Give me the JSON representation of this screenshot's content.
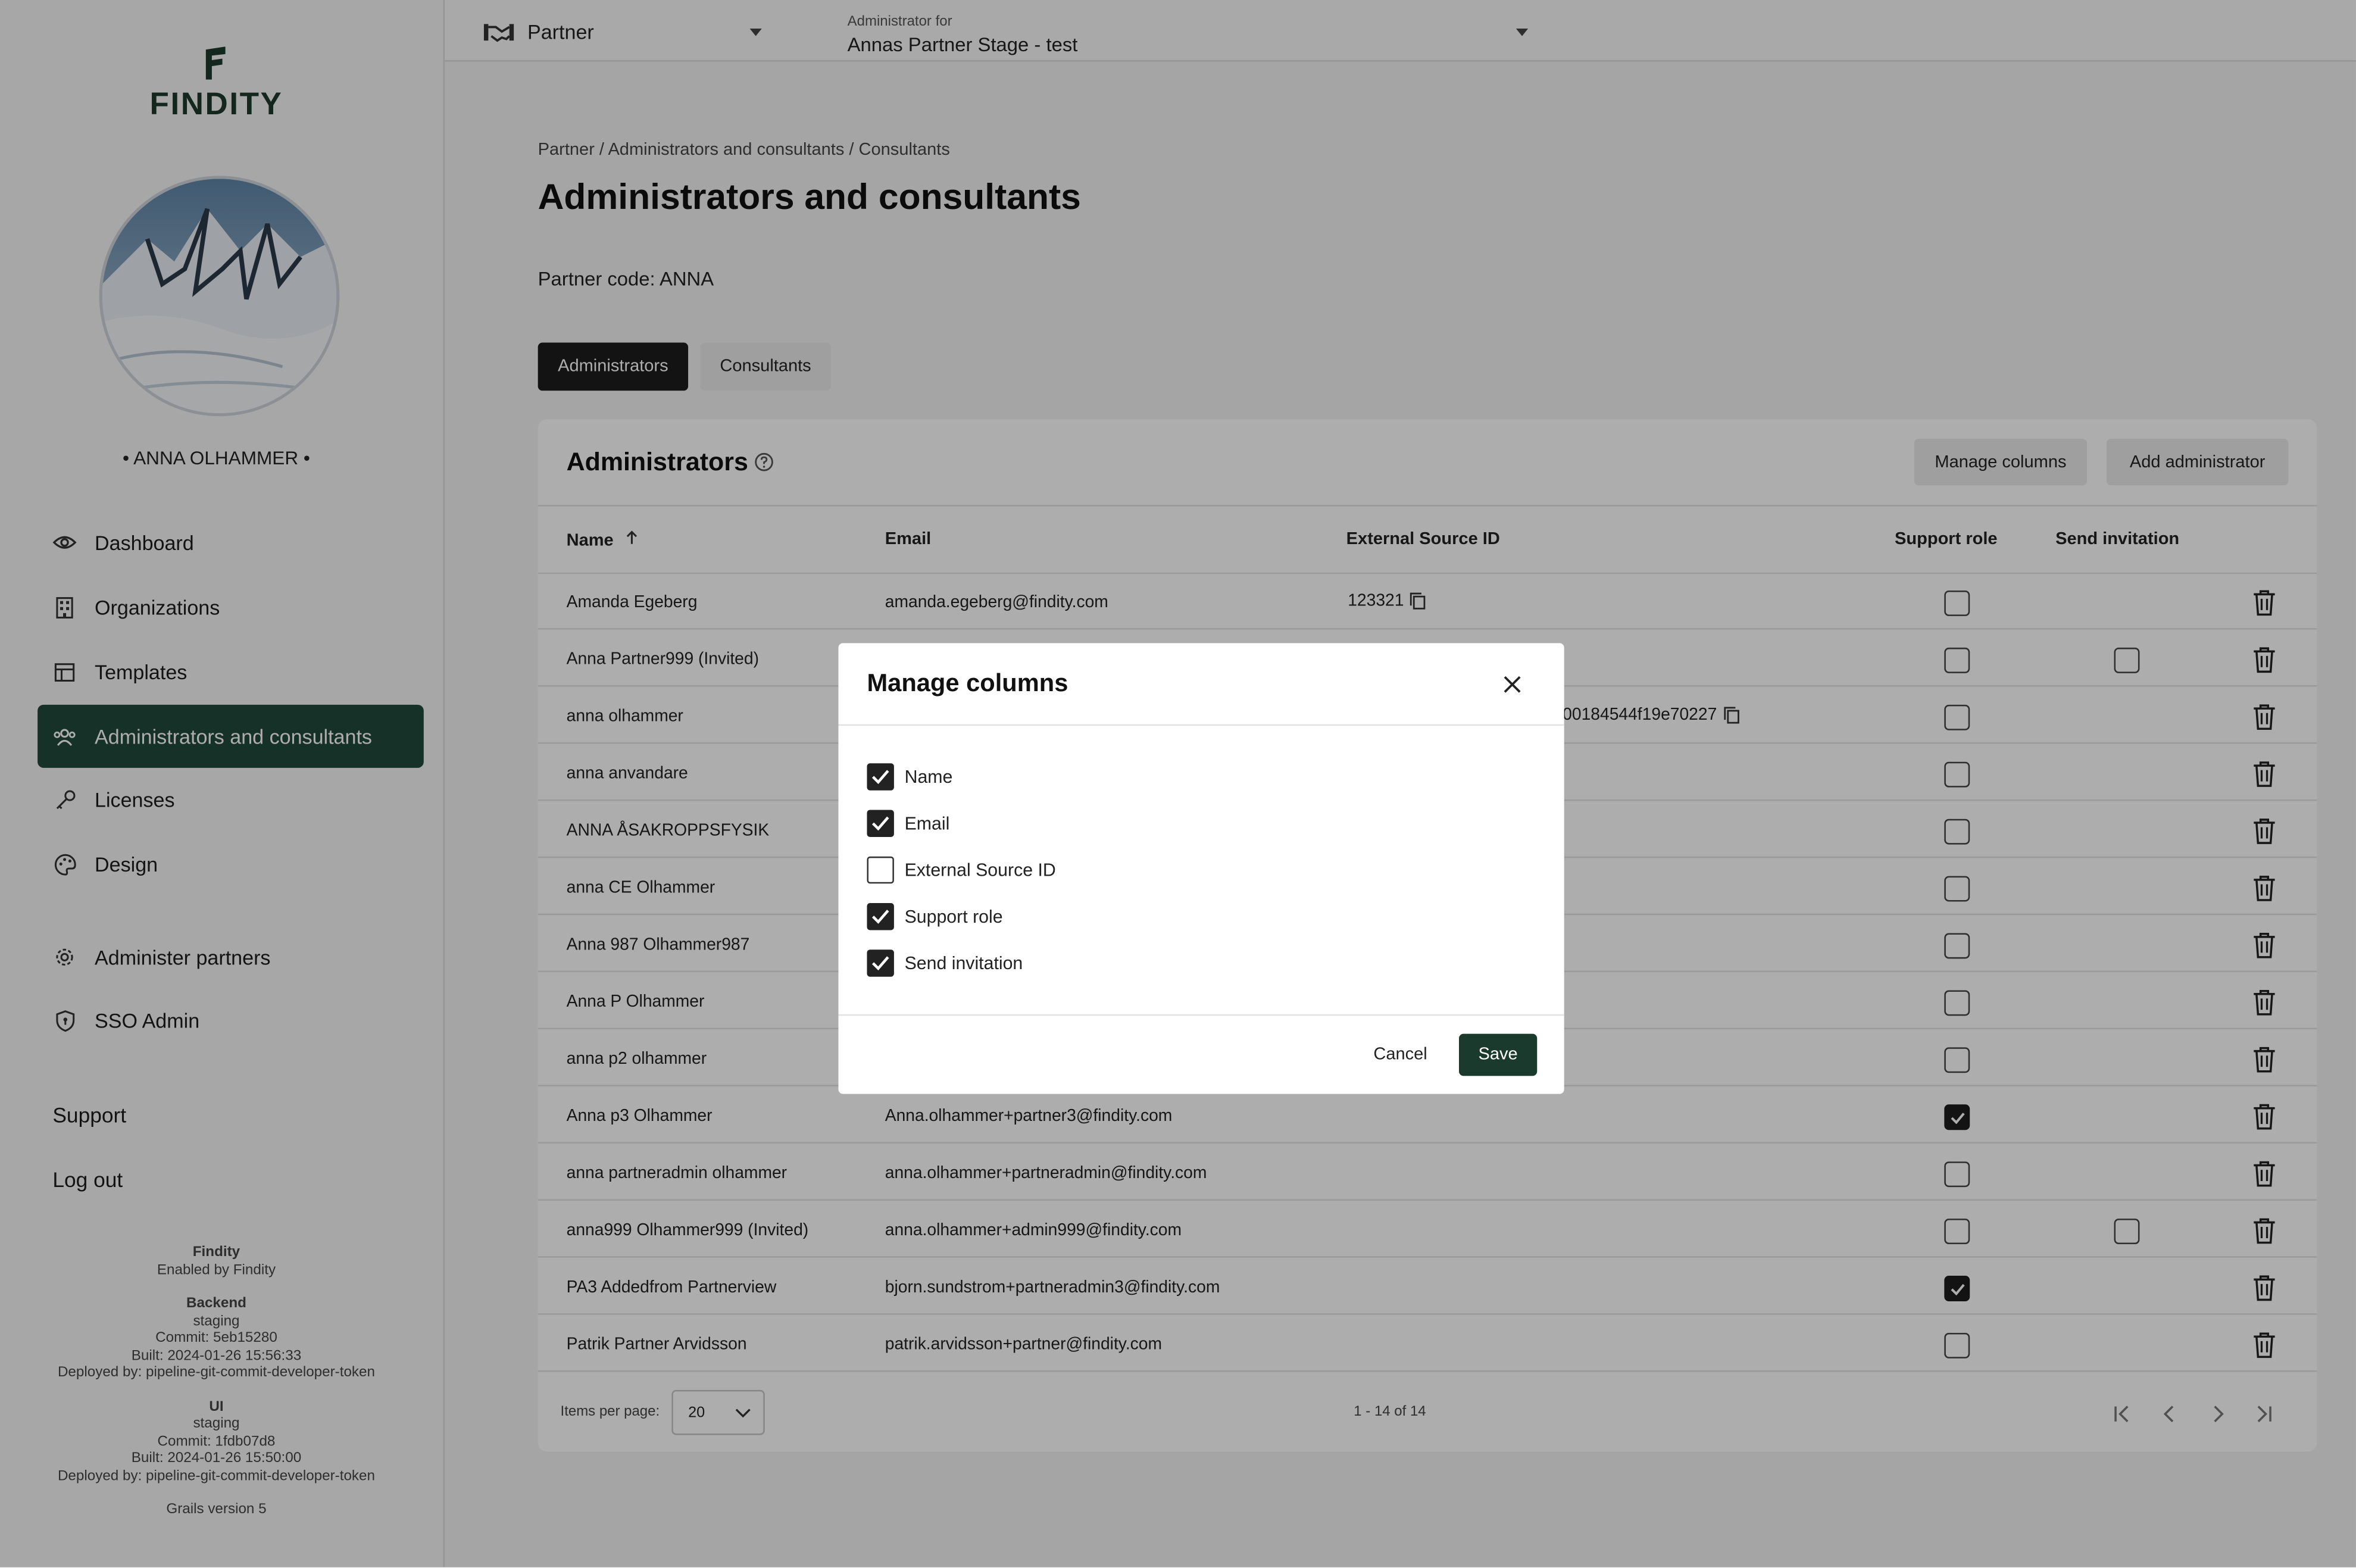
{
  "brand": {
    "name": "FINDITY"
  },
  "user": {
    "name": "• ANNA OLHAMMER •"
  },
  "sidebar": {
    "nav": [
      {
        "label": "Dashboard",
        "icon": "eye-icon",
        "active": false
      },
      {
        "label": "Organizations",
        "icon": "building-icon",
        "active": false
      },
      {
        "label": "Templates",
        "icon": "table-icon",
        "active": false
      },
      {
        "label": "Administrators and consultants",
        "icon": "users-icon",
        "active": true
      },
      {
        "label": "Licenses",
        "icon": "key-icon",
        "active": false
      },
      {
        "label": "Design",
        "icon": "palette-icon",
        "active": false
      }
    ],
    "admin_nav": [
      {
        "label": "Administer partners",
        "icon": "gear-icon"
      },
      {
        "label": "SSO Admin",
        "icon": "shield-icon"
      }
    ],
    "support": "Support",
    "logout": "Log out",
    "build": {
      "findity_title": "Findity",
      "findity_sub": "Enabled by Findity",
      "backend_title": "Backend",
      "backend_env": "staging",
      "backend_commit": "Commit: 5eb15280",
      "backend_built": "Built: 2024-01-26 15:56:33",
      "backend_deployed": "Deployed by: pipeline-git-commit-developer-token",
      "ui_title": "UI",
      "ui_env": "staging",
      "ui_commit": "Commit: 1fdb07d8",
      "ui_built": "Built: 2024-01-26 15:50:00",
      "ui_deployed": "Deployed by: pipeline-git-commit-developer-token",
      "grails": "Grails version 5"
    }
  },
  "topbar": {
    "context_label": "Partner",
    "admin_for_label": "Administrator for",
    "admin_for_value": "Annas Partner Stage - test"
  },
  "breadcrumb": "Partner / Administrators and consultants / Consultants",
  "page_title": "Administrators and consultants",
  "partner_code": "Partner code: ANNA",
  "tabs": {
    "administrators": "Administrators",
    "consultants": "Consultants"
  },
  "card": {
    "title": "Administrators",
    "manage_columns": "Manage columns",
    "add_admin": "Add administrator"
  },
  "table": {
    "headers": {
      "name": "Name",
      "email": "Email",
      "external": "External Source ID",
      "support": "Support role",
      "invite": "Send invitation"
    },
    "rows": [
      {
        "name": "Amanda Egeberg",
        "email": "amanda.egeberg@findity.com",
        "ext": "123321",
        "support": false,
        "invite": null
      },
      {
        "name": "Anna Partner999  (Invited)",
        "email": "",
        "ext": "",
        "support": false,
        "invite": false
      },
      {
        "name": "anna olhammer",
        "email": "",
        "ext": "00184544f19e70227",
        "support": false,
        "invite": null
      },
      {
        "name": "anna anvandare",
        "email": "",
        "ext": "",
        "support": false,
        "invite": null
      },
      {
        "name": "ANNA ÅSAKROPPSFYSIK",
        "email": "",
        "ext": "",
        "support": false,
        "invite": null
      },
      {
        "name": "anna CE Olhammer",
        "email": "",
        "ext": "",
        "support": false,
        "invite": null
      },
      {
        "name": "Anna 987 Olhammer987",
        "email": "",
        "ext": "",
        "support": false,
        "invite": null
      },
      {
        "name": "Anna P Olhammer",
        "email": "",
        "ext": "",
        "support": false,
        "invite": null
      },
      {
        "name": "anna p2 olhammer",
        "email": "",
        "ext": "",
        "support": false,
        "invite": null
      },
      {
        "name": "Anna p3 Olhammer",
        "email": "Anna.olhammer+partner3@findity.com",
        "ext": "",
        "support": true,
        "invite": null
      },
      {
        "name": "anna partneradmin olhammer",
        "email": "anna.olhammer+partneradmin@findity.com",
        "ext": "",
        "support": false,
        "invite": null
      },
      {
        "name": "anna999 Olhammer999  (Invited)",
        "email": "anna.olhammer+admin999@findity.com",
        "ext": "",
        "support": false,
        "invite": false
      },
      {
        "name": "PA3 Addedfrom Partnerview",
        "email": "bjorn.sundstrom+partneradmin3@findity.com",
        "ext": "",
        "support": true,
        "invite": null
      },
      {
        "name": "Patrik Partner Arvidsson",
        "email": "patrik.arvidsson+partner@findity.com",
        "ext": "",
        "support": false,
        "invite": null
      }
    ]
  },
  "pagination": {
    "items_per_page_label": "Items per page:",
    "items_per_page_value": "20",
    "range": "1 - 14 of 14"
  },
  "modal": {
    "title": "Manage columns",
    "options": [
      {
        "label": "Name",
        "checked": true
      },
      {
        "label": "Email",
        "checked": true
      },
      {
        "label": "External Source ID",
        "checked": false
      },
      {
        "label": "Support role",
        "checked": true
      },
      {
        "label": "Send invitation",
        "checked": true
      }
    ],
    "cancel": "Cancel",
    "save": "Save"
  },
  "colors": {
    "accent": "#214a3b",
    "save_button": "#1a3a2e",
    "overlay": "rgba(0,0,0,0.32)"
  }
}
